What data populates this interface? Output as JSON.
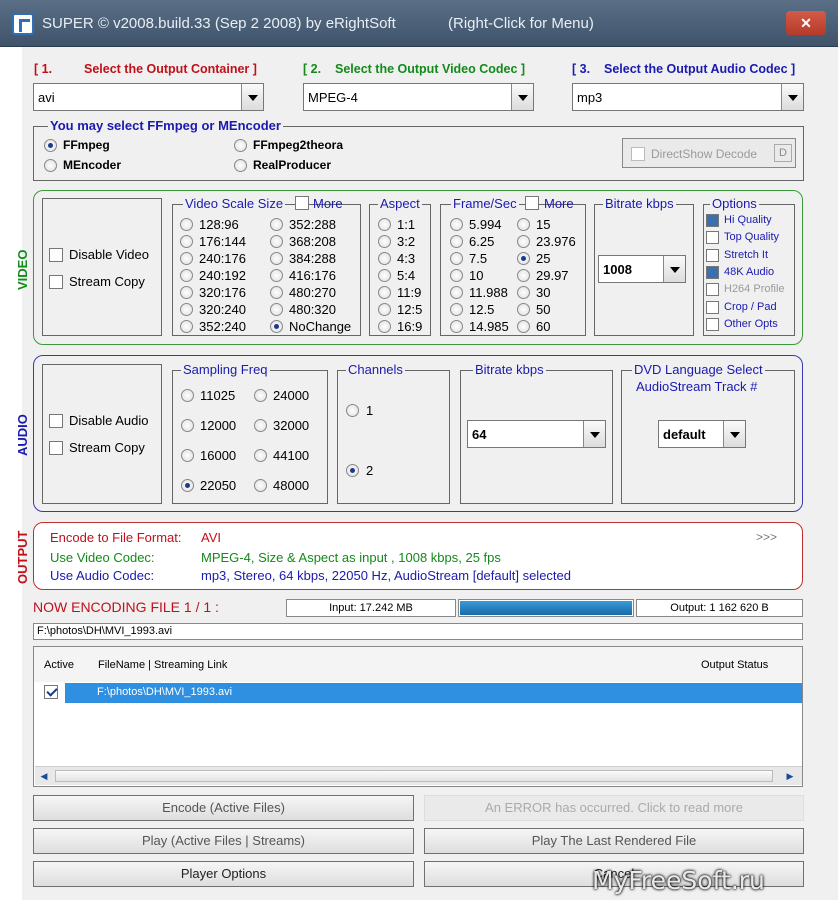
{
  "window": {
    "title": "SUPER © v2008.build.33 (Sep 2 2008) by eRightSoft",
    "hint": "(Right-Click for Menu)",
    "close_glyph": "✕"
  },
  "step1": {
    "num": "[ 1.",
    "label": "Select the Output Container ]",
    "value": "avi"
  },
  "step2": {
    "num": "[ 2.",
    "label": "Select the Output Video Codec ]",
    "value": "MPEG-4"
  },
  "step3": {
    "num": "[ 3.",
    "label": "Select the Output Audio Codec ]",
    "value": "mp3"
  },
  "encoder": {
    "legend": "You may select FFmpeg or MEncoder",
    "options": [
      "FFmpeg",
      "MEncoder",
      "FFmpeg2theora",
      "RealProducer"
    ],
    "selected": "FFmpeg",
    "directshow_label": "DirectShow Decode",
    "directshow_btn": "D"
  },
  "video": {
    "section_label": "VIDEO",
    "disable_label": "Disable Video",
    "stream_copy_label": "Stream Copy",
    "scale_legend": "Video Scale Size",
    "scale_more": "More",
    "scale_col1": [
      "128:96",
      "176:144",
      "240:176",
      "240:192",
      "320:176",
      "320:240",
      "352:240"
    ],
    "scale_col2": [
      "352:288",
      "368:208",
      "384:288",
      "416:176",
      "480:270",
      "480:320",
      "NoChange"
    ],
    "scale_selected": "NoChange",
    "aspect_legend": "Aspect",
    "aspects": [
      "1:1",
      "3:2",
      "4:3",
      "5:4",
      "11:9",
      "12:5",
      "16:9"
    ],
    "fps_legend": "Frame/Sec",
    "fps_more": "More",
    "fps_col1": [
      "5.994",
      "6.25",
      "7.5",
      "10",
      "11.988",
      "12.5",
      "14.985"
    ],
    "fps_col2": [
      "15",
      "23.976",
      "25",
      "29.97",
      "30",
      "50",
      "60"
    ],
    "fps_selected": "25",
    "bitrate_legend": "Bitrate  kbps",
    "bitrate_value": "1008",
    "options_legend": "Options",
    "options": [
      {
        "label": "Hi Quality",
        "checked": true,
        "color": "#1a1ab0"
      },
      {
        "label": "Top Quality",
        "checked": false,
        "color": "#1a1ab0"
      },
      {
        "label": "Stretch It",
        "checked": false,
        "color": "#1a1ab0"
      },
      {
        "label": "48K Audio",
        "checked": true,
        "color": "#1a1ab0"
      },
      {
        "label": "H264 Profile",
        "checked": false,
        "color": "#9a9a9a"
      },
      {
        "label": "Crop / Pad",
        "checked": false,
        "color": "#1a1ab0"
      },
      {
        "label": "Other Opts",
        "checked": false,
        "color": "#1a1ab0"
      }
    ]
  },
  "audio": {
    "section_label": "AUDIO",
    "disable_label": "Disable Audio",
    "stream_copy_label": "Stream Copy",
    "freq_legend": "Sampling Freq",
    "freq_col1": [
      "11025",
      "12000",
      "16000",
      "22050"
    ],
    "freq_col2": [
      "24000",
      "32000",
      "44100",
      "48000"
    ],
    "freq_selected": "22050",
    "channels_legend": "Channels",
    "channels": [
      "1",
      "2"
    ],
    "channels_selected": "2",
    "bitrate_legend": "Bitrate  kbps",
    "bitrate_value": "64",
    "dvd_legend_1": "DVD Language Select",
    "dvd_legend_2": "AudioStream  Track #",
    "dvd_value": "default"
  },
  "output": {
    "section_label": "OUTPUT",
    "line1_label": "Encode to File Format:",
    "line1_value": "AVI",
    "line2_label": "Use Video Codec:",
    "line2_value": "MPEG-4,  Size & Aspect as input ,  1008 kbps,  25 fps",
    "line3_label": "Use Audio Codec:",
    "line3_value": "mp3,  Stereo,  64 kbps,  22050 Hz,  AudioStream [default] selected",
    "more_glyph": ">>>"
  },
  "encoding": {
    "status": "NOW ENCODING FILE 1 / 1 :",
    "input": "Input: 17.242 MB",
    "output": "Output: 1 162 620 B",
    "progress": 1.0,
    "current_file": "F:\\photos\\DH\\MVI_1993.avi"
  },
  "filelist": {
    "col_active": "Active",
    "col_filename": "FileName  |  Streaming Link",
    "col_status": "Output Status",
    "rows": [
      {
        "active": true,
        "file": "F:\\photos\\DH\\MVI_1993.avi"
      }
    ],
    "scroll_left": "◀",
    "scroll_right": "▶"
  },
  "buttons": {
    "encode": "Encode (Active Files)",
    "error": "An ERROR has occurred. Click to read more",
    "play": "Play (Active Files | Streams)",
    "play_last": "Play The Last Rendered File",
    "player_options": "Player Options",
    "cancel": "Cancel"
  },
  "watermark": "MyFreeSoft.ru"
}
